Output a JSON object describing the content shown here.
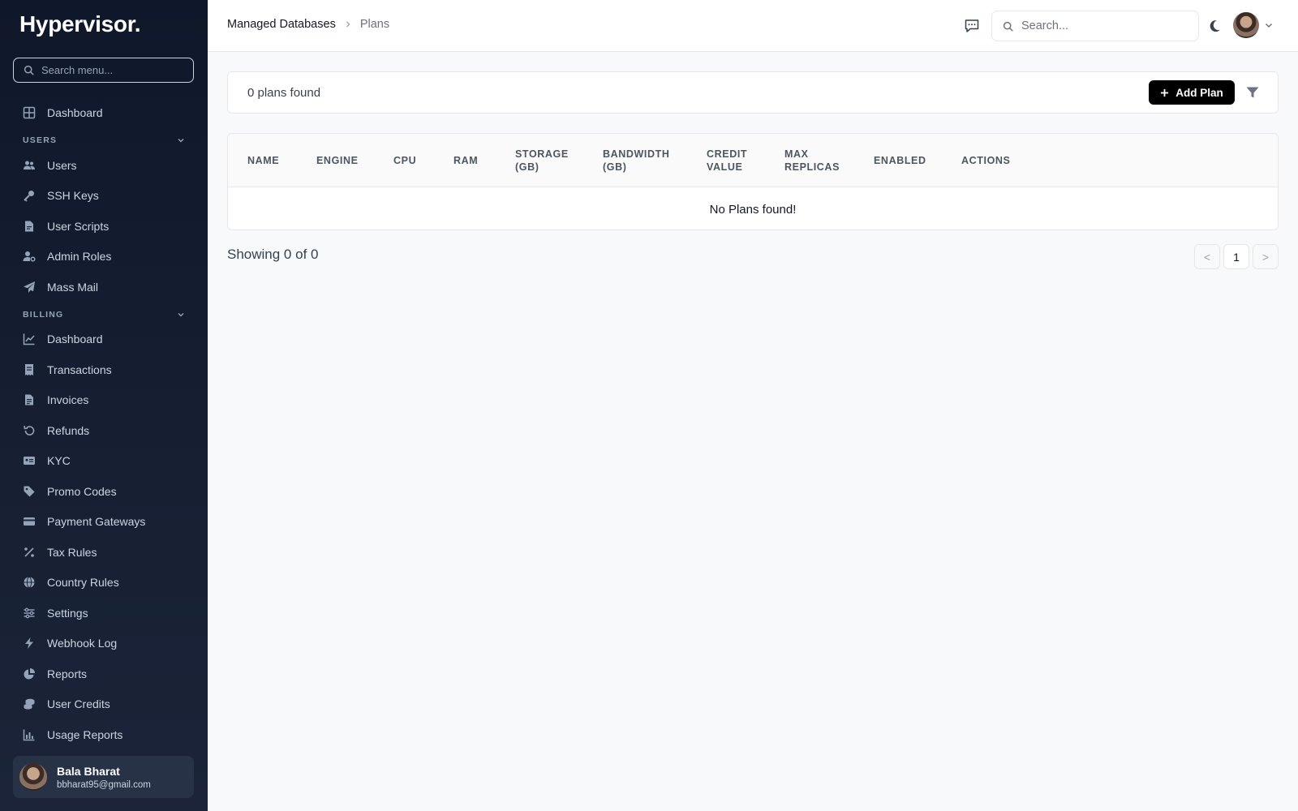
{
  "app": {
    "logo": "Hypervisor."
  },
  "sidebar": {
    "search_placeholder": "Search menu...",
    "top_item": {
      "label": "Dashboard",
      "icon": "grid-icon"
    },
    "sections": [
      {
        "title": "USERS",
        "items": [
          {
            "label": "Users",
            "icon": "users-icon"
          },
          {
            "label": "SSH Keys",
            "icon": "key-icon"
          },
          {
            "label": "User Scripts",
            "icon": "script-icon"
          },
          {
            "label": "Admin Roles",
            "icon": "user-cog-icon"
          },
          {
            "label": "Mass Mail",
            "icon": "paper-plane-icon"
          }
        ]
      },
      {
        "title": "BILLING",
        "items": [
          {
            "label": "Dashboard",
            "icon": "line-chart-icon"
          },
          {
            "label": "Transactions",
            "icon": "receipt-icon"
          },
          {
            "label": "Invoices",
            "icon": "invoice-icon"
          },
          {
            "label": "Refunds",
            "icon": "undo-icon"
          },
          {
            "label": "KYC",
            "icon": "id-card-icon"
          },
          {
            "label": "Promo Codes",
            "icon": "tag-icon"
          },
          {
            "label": "Payment Gateways",
            "icon": "credit-card-icon"
          },
          {
            "label": "Tax Rules",
            "icon": "percent-icon"
          },
          {
            "label": "Country Rules",
            "icon": "globe-icon"
          },
          {
            "label": "Settings",
            "icon": "sliders-icon"
          },
          {
            "label": "Webhook Log",
            "icon": "bolt-icon"
          },
          {
            "label": "Reports",
            "icon": "pie-chart-icon"
          },
          {
            "label": "User Credits",
            "icon": "coins-icon"
          },
          {
            "label": "Usage Reports",
            "icon": "bar-chart-icon"
          }
        ]
      }
    ],
    "user": {
      "name": "Bala Bharat",
      "email": "bbharat95@gmail.com"
    }
  },
  "header": {
    "breadcrumb": [
      "Managed Databases",
      "Plans"
    ],
    "search_placeholder": "Search..."
  },
  "main": {
    "count_text": "0 plans found",
    "add_button": "Add Plan",
    "table": {
      "columns": [
        "NAME",
        "ENGINE",
        "CPU",
        "RAM",
        "STORAGE\n(GB)",
        "BANDWIDTH\n(GB)",
        "CREDIT\nVALUE",
        "MAX\nREPLICAS",
        "ENABLED",
        "ACTIONS"
      ],
      "empty_text": "No Plans found!"
    },
    "showing_text": "Showing 0 of 0",
    "pagination": {
      "prev": "<",
      "current": "1",
      "next": ">"
    }
  }
}
